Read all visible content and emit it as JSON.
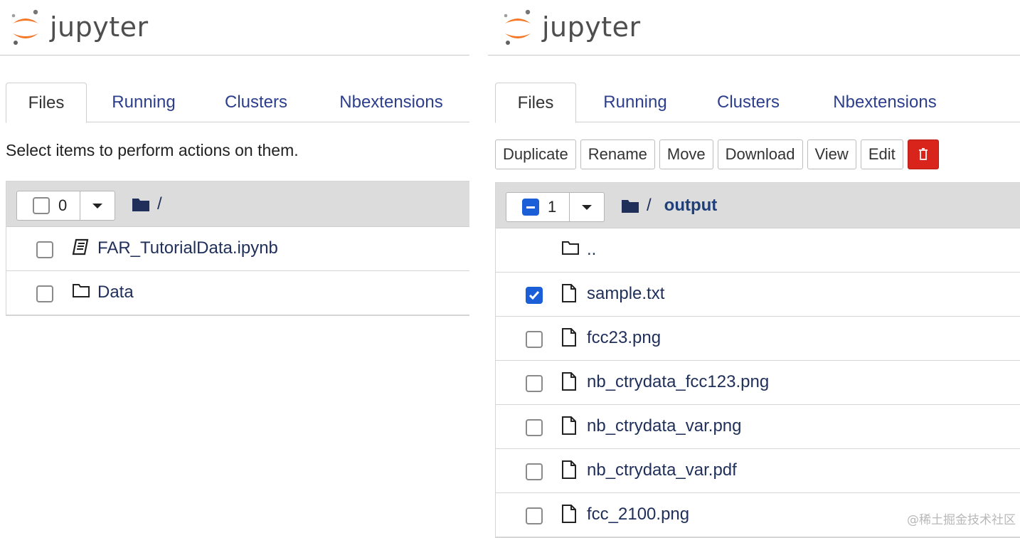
{
  "left": {
    "brand": "jupyter",
    "tabs": [
      {
        "label": "Files",
        "active": true
      },
      {
        "label": "Running",
        "active": false
      },
      {
        "label": "Clusters",
        "active": false
      },
      {
        "label": "Nbextensions",
        "active": false
      }
    ],
    "hint": "Select items to perform actions on them.",
    "selection_count": "0",
    "breadcrumb": [
      "/"
    ],
    "items": [
      {
        "name": "FAR_TutorialData.ipynb",
        "icon": "notebook-icon",
        "checked": false
      },
      {
        "name": "Data",
        "icon": "folder-icon",
        "checked": false
      }
    ]
  },
  "right": {
    "brand": "jupyter",
    "tabs": [
      {
        "label": "Files",
        "active": true
      },
      {
        "label": "Running",
        "active": false
      },
      {
        "label": "Clusters",
        "active": false
      },
      {
        "label": "Nbextensions",
        "active": false
      }
    ],
    "actions": {
      "duplicate": "Duplicate",
      "rename": "Rename",
      "move": "Move",
      "download": "Download",
      "view": "View",
      "edit": "Edit",
      "delete_icon": "trash-icon"
    },
    "selection_count": "1",
    "breadcrumb": [
      "/",
      "output"
    ],
    "parent_dir": "..",
    "items": [
      {
        "name": "sample.txt",
        "icon": "file-icon",
        "checked": true
      },
      {
        "name": "fcc23.png",
        "icon": "file-icon",
        "checked": false
      },
      {
        "name": "nb_ctrydata_fcc123.png",
        "icon": "file-icon",
        "checked": false
      },
      {
        "name": "nb_ctrydata_var.png",
        "icon": "file-icon",
        "checked": false
      },
      {
        "name": "nb_ctrydata_var.pdf",
        "icon": "file-icon",
        "checked": false
      },
      {
        "name": "fcc_2100.png",
        "icon": "file-icon",
        "checked": false
      }
    ]
  },
  "watermark": "@稀土掘金技术社区",
  "colors": {
    "link": "#1f2f5a",
    "tab_link": "#2c3e8c",
    "header_bar": "#dcdcdc",
    "accent_blue": "#1a5fd8",
    "danger": "#d9241c",
    "logo_orange": "#f37726"
  }
}
